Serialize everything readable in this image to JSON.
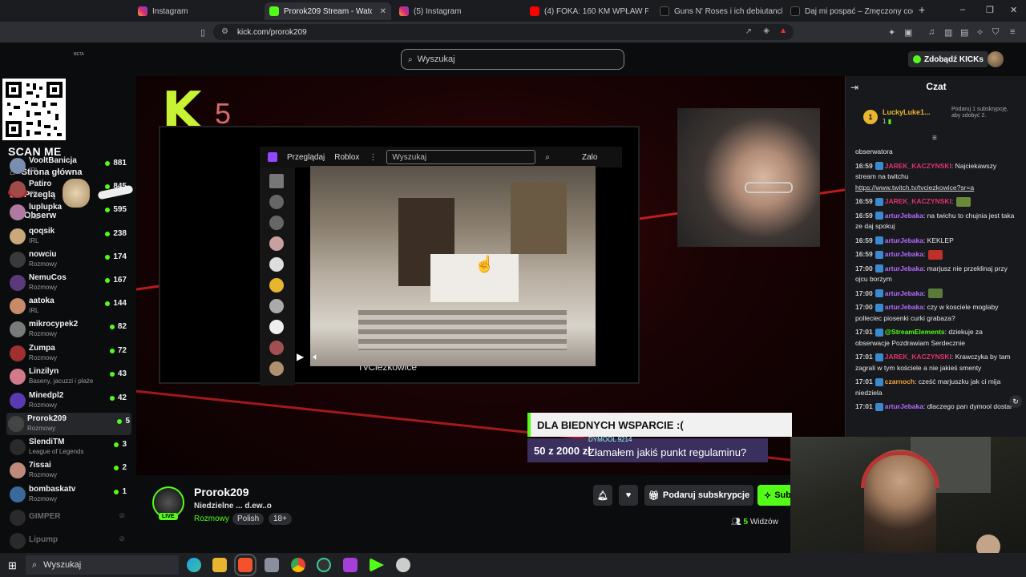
{
  "browser": {
    "tabs": [
      {
        "label": "Instagram",
        "active": false
      },
      {
        "label": "Prorok209 Stream - Watch Li",
        "active": true
      },
      {
        "label": "(5) Instagram",
        "active": false
      },
      {
        "label": "(4) FOKA: 160 KM WPŁAW PRZEZ BA",
        "active": false
      },
      {
        "label": "Guns N' Roses i ich debiutancki albu",
        "active": false
      },
      {
        "label": "Daj mi pospać – Zmęczony codzienn",
        "active": false
      }
    ],
    "new_tab": "+",
    "url": "kick.com/prorok209",
    "window_controls": [
      "–",
      "❐",
      "✕"
    ]
  },
  "header": {
    "search_placeholder": "Wyszukaj",
    "kicks_button": "Zdobądź KICKs",
    "beta_label": "BETA"
  },
  "sidebar": {
    "scan_me": "SCAN ME",
    "nav": [
      {
        "label": "Strona główna",
        "icon": "home-icon"
      },
      {
        "label": "Przeglą",
        "icon": "browse-icon"
      },
      {
        "label": "Obserw",
        "icon": "following-icon"
      }
    ],
    "channels": [
      {
        "name": "VooltBanicja",
        "category": "IRL",
        "viewers": "881",
        "live": true,
        "color": "#7a8fb0"
      },
      {
        "name": "Patiro",
        "category": "IRL",
        "viewers": "845",
        "live": true,
        "color": "#a04a4a"
      },
      {
        "name": "luplupka",
        "category": "IRL",
        "viewers": "595",
        "live": true,
        "color": "#b07aa0"
      },
      {
        "name": "qoqsik",
        "category": "IRL",
        "viewers": "238",
        "live": true,
        "color": "#c9a87a"
      },
      {
        "name": "nowciu",
        "category": "Rozmowy",
        "viewers": "174",
        "live": true,
        "color": "#3a3a3a"
      },
      {
        "name": "NemuCos",
        "category": "Rozmowy",
        "viewers": "167",
        "live": true,
        "color": "#5a3a7a"
      },
      {
        "name": "aatoka",
        "category": "IRL",
        "viewers": "144",
        "live": true,
        "color": "#c98a6a"
      },
      {
        "name": "mikrocypek2",
        "category": "Rozmowy",
        "viewers": "82",
        "live": true,
        "color": "#7a7a7a"
      },
      {
        "name": "Zumpa",
        "category": "Rozmowy",
        "viewers": "72",
        "live": true,
        "color": "#a03030"
      },
      {
        "name": "Linzilyn",
        "category": "Baseny, jacuzzi i plaże",
        "viewers": "43",
        "live": true,
        "color": "#d07a8a"
      },
      {
        "name": "Minedpl2",
        "category": "Rozmowy",
        "viewers": "42",
        "live": true,
        "color": "#5a3ab0"
      },
      {
        "name": "Prorok209",
        "category": "Rozmowy",
        "viewers": "5",
        "live": true,
        "color": "#444",
        "selected": true
      },
      {
        "name": "SlendiTM",
        "category": "League of Legends",
        "viewers": "3",
        "live": true,
        "color": "#2a2a2a"
      },
      {
        "name": "7issai",
        "category": "Rozmowy",
        "viewers": "2",
        "live": true,
        "color": "#c08a7a"
      },
      {
        "name": "bombaskatv",
        "category": "Rozmowy",
        "viewers": "1",
        "live": true,
        "color": "#3a6a9a"
      },
      {
        "name": "GIMPER",
        "category": "",
        "viewers": "",
        "live": false,
        "color": "#2a2a2a"
      },
      {
        "name": "Lipump",
        "category": "",
        "viewers": "",
        "live": false,
        "color": "#2a2a2a"
      }
    ]
  },
  "stream": {
    "overlay_logo": "K",
    "overlay_number": "5",
    "inner_nav": [
      "Przeglądaj",
      "Roblox"
    ],
    "inner_search": "Wyszukaj",
    "inner_login": "Zalo",
    "inner_channel": "TvCiezkowice",
    "donation_title": "DLA BIEDNYCH WSPARCIE :(",
    "donation_progress": "50 z 2000 zł",
    "donation_user": "DYMOOL 9214",
    "donation_message": "Złamałem jakiś punkt regulaminu?"
  },
  "channel": {
    "name": "Prorok209",
    "title": "Niedzielne ... d.ew..o",
    "category": "Rozmowy",
    "tags": [
      "Polish",
      "18+"
    ],
    "live_badge": "LIVE",
    "subscribe_gift": "Podaruj subskrypcje",
    "subscribe": "Sub",
    "viewers_count": "5",
    "viewers_label": "Widzów"
  },
  "chat": {
    "title": "Czat",
    "gifter_rank": "1",
    "gifter_name": "LuckyLuke1...",
    "gifter_count": "1",
    "gifter_note": "Podaruj 1 subskrypcję, aby zdobyć 2.",
    "messages": [
      {
        "time": "",
        "user": "",
        "color": "#ddd",
        "text": "obserwatora"
      },
      {
        "time": "16:59",
        "user": "JAREK_KACZYNSKI",
        "color": "#e0336b",
        "text": ": Najciekawszy stream na twitchu",
        "link": "https://www.twitch.tv/tvciezkowice?sr=a"
      },
      {
        "time": "16:59",
        "user": "JAREK_KACZYNSKI",
        "color": "#e0336b",
        "text": ":",
        "emote": "#6a8a3a"
      },
      {
        "time": "16:59",
        "user": "arturJebaka",
        "color": "#b36bff",
        "text": ": na twichu to chujnia jest taka ze daj spokuj"
      },
      {
        "time": "16:59",
        "user": "arturJebaka",
        "color": "#b36bff",
        "text": ": KEKLEP"
      },
      {
        "time": "16:59",
        "user": "arturJebaka",
        "color": "#b36bff",
        "text": ":",
        "emote": "#c0302a"
      },
      {
        "time": "17:00",
        "user": "arturJebaka",
        "color": "#b36bff",
        "text": ": marjusz nie przeklinaj przy ojcu borzym"
      },
      {
        "time": "17:00",
        "user": "arturJebaka",
        "color": "#b36bff",
        "text": ":",
        "emote": "#5a7a3a"
      },
      {
        "time": "17:00",
        "user": "arturJebaka",
        "color": "#b36bff",
        "text": ": czy w kosciele moglaby polleciec piosenki curki grabaza?"
      },
      {
        "time": "17:01",
        "user": "@StreamElements",
        "color": "#53fc18",
        "text": ": dziekuje za obserwacje Pozdrawiam Serdecznie"
      },
      {
        "time": "17:01",
        "user": "JAREK_KACZYNSKI",
        "color": "#e0336b",
        "text": ": Krawczyka by tam zagrali w tym kościele a nie jakieś smenty"
      },
      {
        "time": "17:01",
        "user": "czarnoch",
        "color": "#f2a43a",
        "text": ": cześć marjuszku jak ci mija niedziela"
      },
      {
        "time": "17:01",
        "user": "arturJebaka",
        "color": "#b36bff",
        "text": ": dlaczego pan dymool dostal"
      }
    ]
  },
  "taskbar": {
    "search_placeholder": "Wyszukaj"
  }
}
